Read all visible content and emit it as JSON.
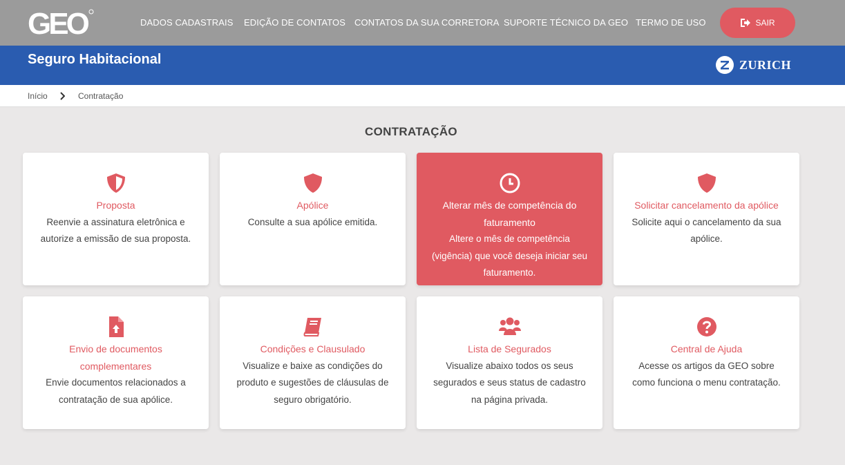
{
  "app": {
    "logo_text": "GEO"
  },
  "nav": {
    "items": [
      {
        "label": "DADOS CADASTRAIS"
      },
      {
        "label": "EDIÇÃO DE CONTATOS"
      },
      {
        "label": "CONTATOS DA SUA CORRETORA"
      },
      {
        "label": "SUPORTE TÉCNICO DA GEO"
      },
      {
        "label": "TERMO DE USO"
      }
    ],
    "logout_label": "SAIR"
  },
  "banner": {
    "title": "Seguro Habitacional",
    "brand": "ZURICH"
  },
  "breadcrumb": {
    "home": "Início",
    "current": "Contratação"
  },
  "main": {
    "title": "CONTRATAÇÃO",
    "cards": [
      {
        "title": "Proposta",
        "desc": "Reenvie a assinatura eletrônica e autorize a emissão de sua proposta.",
        "icon": "shield-half-icon"
      },
      {
        "title": "Apólice",
        "desc": "Consulte a sua apólice emitida.",
        "icon": "shield-icon"
      },
      {
        "title": "Alterar mês de competência do faturamento",
        "desc": "Altere o mês de competência (vigência) que você deseja iniciar seu faturamento.",
        "icon": "clock-icon"
      },
      {
        "title": "Solicitar cancelamento da apólice",
        "desc": "Solicite aqui o cancelamento da sua apólice.",
        "icon": "shield-icon"
      },
      {
        "title": "Envio de documentos complementares",
        "desc": "Envie documentos relacionados a contratação de sua apólice.",
        "icon": "file-upload-icon"
      },
      {
        "title": "Condições e Clausulado",
        "desc": "Visualize e baixe as condições do produto e sugestões de cláusulas de seguro obrigatório.",
        "icon": "book-icon"
      },
      {
        "title": "Lista de Segurados",
        "desc": "Visualize abaixo todos os seus segurados e seus status de cadastro na página privada.",
        "icon": "users-icon"
      },
      {
        "title": "Central de Ajuda",
        "desc": "Acesse os artigos da GEO sobre como funciona o menu contratação.",
        "icon": "question-circle-icon"
      }
    ]
  },
  "colors": {
    "accent": "#e05a61",
    "banner": "#2a5cb0",
    "topbar": "#9b9b9b",
    "background": "#eae8e8"
  }
}
